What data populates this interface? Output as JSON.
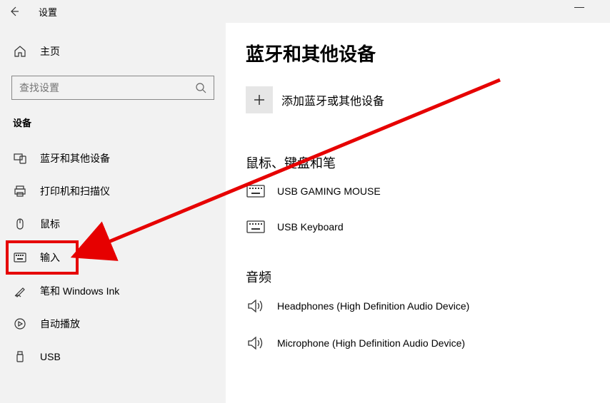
{
  "titlebar": {
    "title": "设置"
  },
  "sidebar": {
    "home": "主页",
    "search_placeholder": "查找设置",
    "section": "设备",
    "items": [
      {
        "label": "蓝牙和其他设备"
      },
      {
        "label": "打印机和扫描仪"
      },
      {
        "label": "鼠标"
      },
      {
        "label": "输入"
      },
      {
        "label": "笔和 Windows Ink"
      },
      {
        "label": "自动播放"
      },
      {
        "label": "USB"
      }
    ]
  },
  "main": {
    "title": "蓝牙和其他设备",
    "add_label": "添加蓝牙或其他设备",
    "section1": "鼠标、键盘和笔",
    "devices1": [
      {
        "label": "USB GAMING MOUSE"
      },
      {
        "label": "USB Keyboard"
      }
    ],
    "section2": "音频",
    "devices2": [
      {
        "label": "Headphones (High Definition Audio Device)"
      },
      {
        "label": "Microphone (High Definition Audio Device)"
      }
    ]
  }
}
